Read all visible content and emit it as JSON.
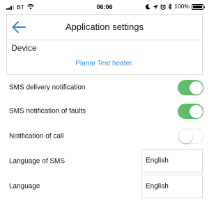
{
  "status_bar": {
    "carrier": "BT",
    "time": "06:06",
    "battery_percent": "100%",
    "icons": [
      "signal-icon",
      "wifi-icon",
      "moon-icon",
      "location-arrow-icon",
      "alarm-icon",
      "bluetooth-icon",
      "battery-icon"
    ]
  },
  "header": {
    "title": "Application settings",
    "back_icon": "arrow-left-icon",
    "accent_color": "#3a86d8"
  },
  "device": {
    "label": "Device",
    "name": "Planar Test heater.",
    "link_color": "#2f8fe0"
  },
  "settings": {
    "sms_delivery": {
      "label": "SMS delivery notification",
      "enabled": true
    },
    "sms_faults": {
      "label": "SMS notification of faults",
      "enabled": true
    },
    "call_notification": {
      "label": "Notification of call",
      "enabled": false
    },
    "sms_language": {
      "label": "Language of SMS",
      "value": "English"
    },
    "app_language": {
      "label": "Language",
      "value": "English"
    },
    "toggle_on_color": "#5fbd6c"
  }
}
